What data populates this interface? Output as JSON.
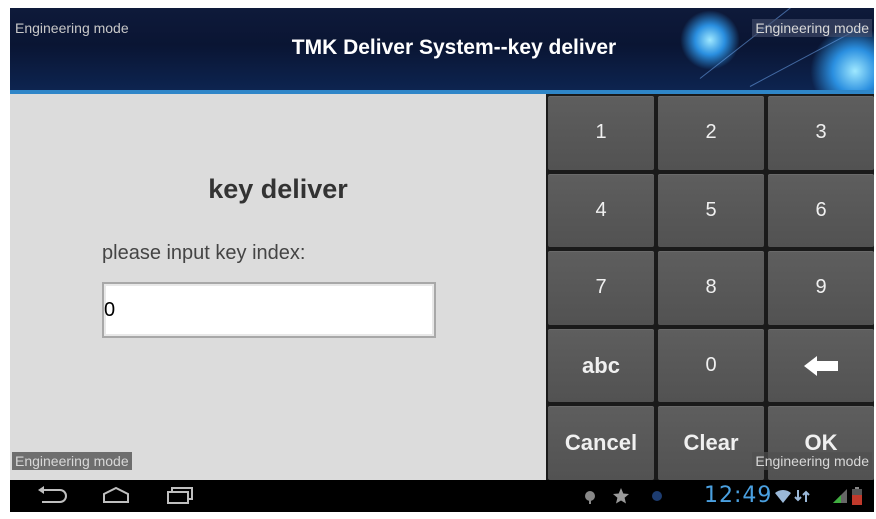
{
  "watermark": "Engineering mode",
  "titlebar": {
    "title": "TMK Deliver System--key deliver"
  },
  "form": {
    "heading": "key deliver",
    "prompt": "please input key index:",
    "key_index_value": "0"
  },
  "keypad": {
    "keys": [
      {
        "label": "1"
      },
      {
        "label": "2"
      },
      {
        "label": "3"
      },
      {
        "label": "4"
      },
      {
        "label": "5"
      },
      {
        "label": "6"
      },
      {
        "label": "7"
      },
      {
        "label": "8"
      },
      {
        "label": "9"
      },
      {
        "label": "abc"
      },
      {
        "label": "0"
      },
      {
        "label": "",
        "icon": "backspace-icon"
      },
      {
        "label": "Cancel"
      },
      {
        "label": "Clear"
      },
      {
        "label": "OK"
      }
    ]
  },
  "statusbar": {
    "time": "12:49",
    "icons": [
      "back-icon",
      "home-icon",
      "recent-apps-icon",
      "usb-icon",
      "star-icon",
      "wifi-icon",
      "signal-icon",
      "battery-icon"
    ]
  },
  "colors": {
    "accent": "#2f86c8",
    "clock": "#4aa0e0",
    "keypad_bg": "#1a1a1a",
    "key_bg": "#585858"
  }
}
